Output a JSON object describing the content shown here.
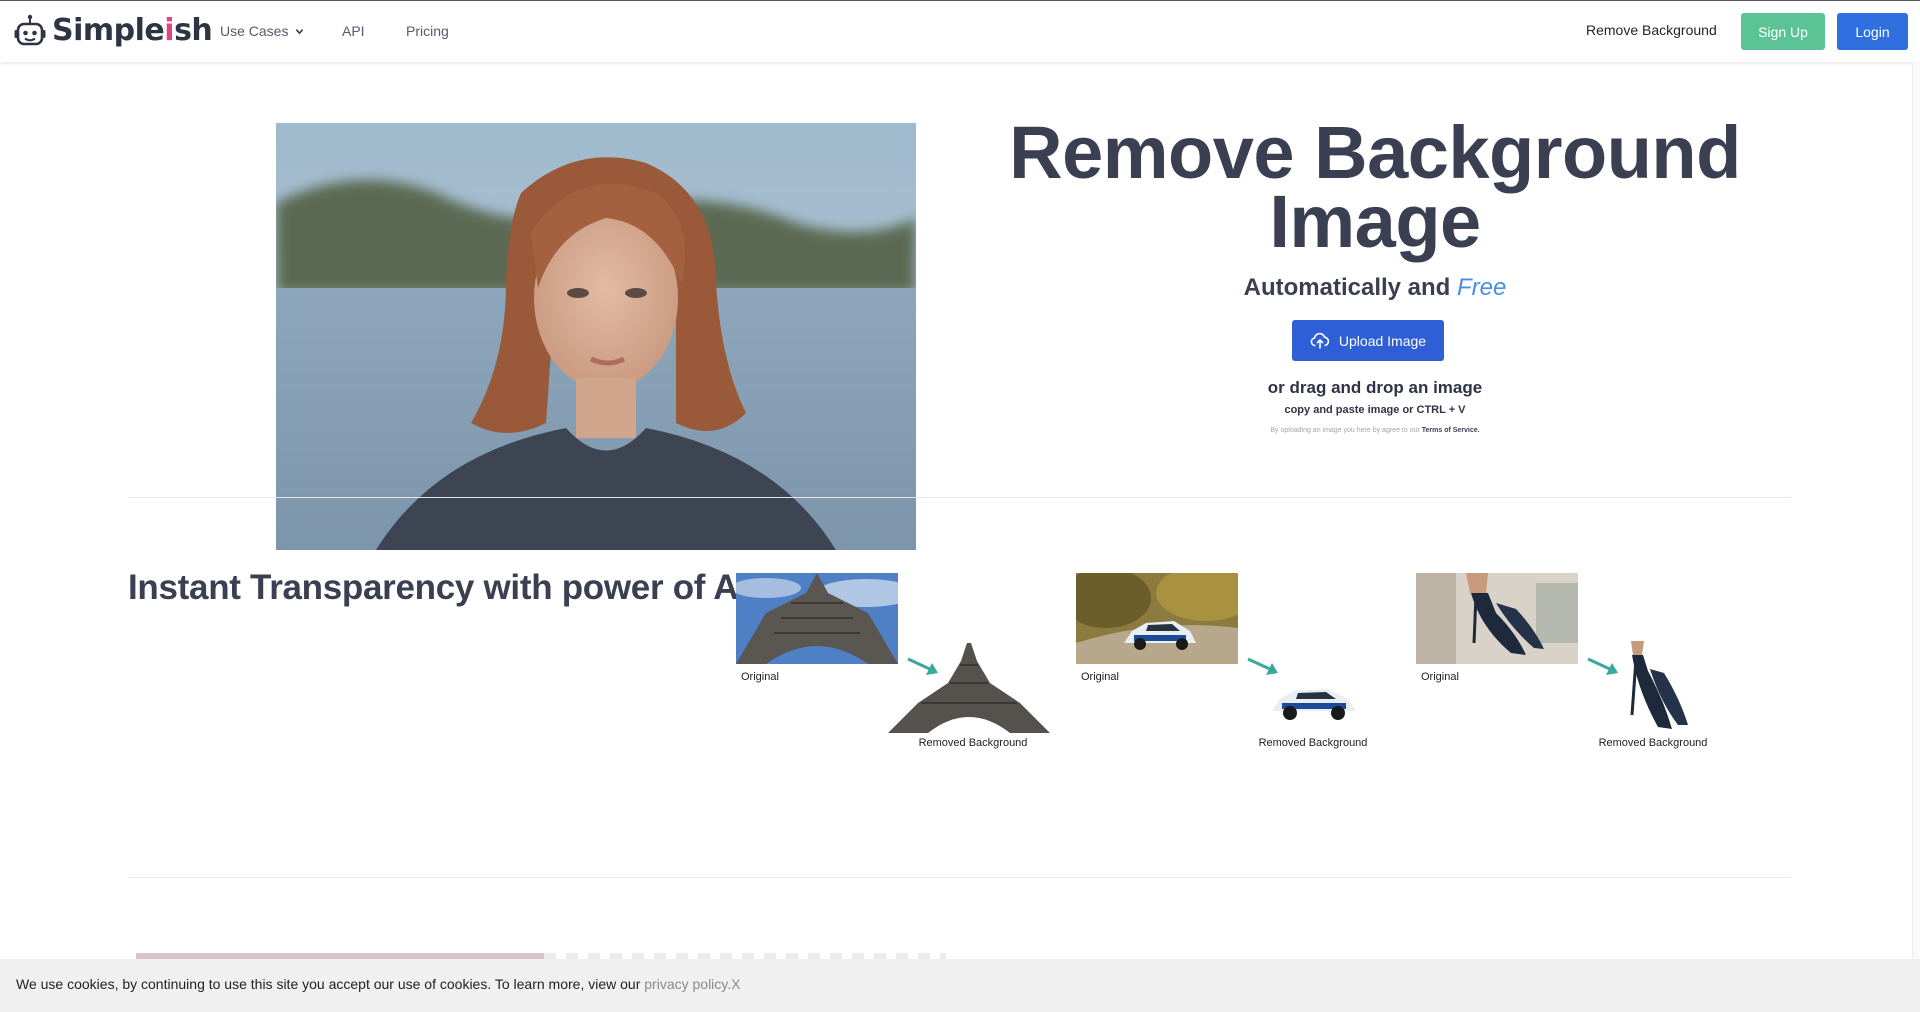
{
  "nav": {
    "logo_prefix": "Simple",
    "logo_i": "i",
    "logo_suffix": "sh",
    "use_cases": "Use Cases",
    "api": "API",
    "pricing": "Pricing",
    "remove_background": "Remove Background",
    "sign_up": "Sign Up",
    "login": "Login"
  },
  "hero": {
    "title_line1": "Remove Background",
    "title_line2": "Image",
    "subtitle_prefix": "Automatically and ",
    "subtitle_free": "Free",
    "upload_label": "Upload Image",
    "drag_text": "or drag and drop an image",
    "paste_text": "copy and paste image or CTRL + V",
    "terms_prefix": "By uploading an image you here by agree to our ",
    "terms_link": "Terms of Service."
  },
  "section": {
    "title": "Instant Transparency with power of AI",
    "examples": [
      {
        "original_label": "Original",
        "result_label": "Removed Background",
        "subject": "eiffel-tower"
      },
      {
        "original_label": "Original",
        "result_label": "Removed Background",
        "subject": "rally-car"
      },
      {
        "original_label": "Original",
        "result_label": "Removed Background",
        "subject": "high-heels"
      }
    ]
  },
  "cookie": {
    "text": "We use cookies, by continuing to use this site you accept our use of cookies. To learn more, view our ",
    "link": "privacy policy",
    "period": ".",
    "close": "X"
  },
  "colors": {
    "signup": "#5cc397",
    "login": "#2f6fe0",
    "upload": "#2f5fd6",
    "free": "#4a8fe6",
    "arrow": "#3aa89a"
  }
}
